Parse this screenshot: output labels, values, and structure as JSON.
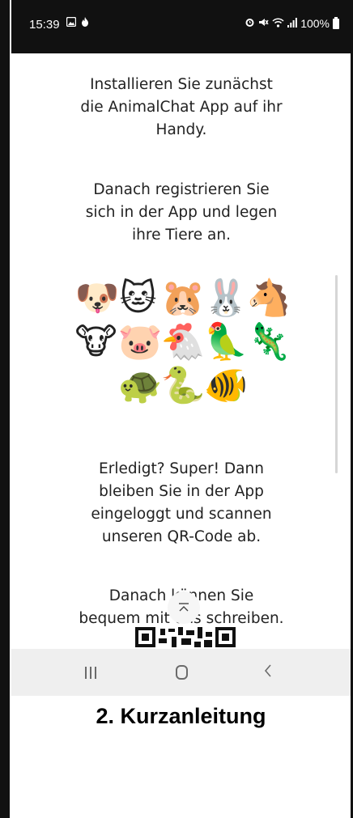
{
  "status_bar": {
    "time": "15:39",
    "battery_text": "100%",
    "left_icons": [
      "gallery-notification-icon",
      "fire-notification-icon"
    ],
    "right_icons": [
      "alarm-icon",
      "mute-icon",
      "wifi-icon",
      "signal-icon",
      "battery-icon"
    ]
  },
  "content": {
    "paragraphs": [
      {
        "lines": [
          "Installieren Sie zunächst",
          "die AnimalChat App auf ihr",
          "Handy."
        ]
      },
      {
        "lines": [
          "Danach registrieren Sie",
          "sich in der App und legen",
          "ihre Tiere an."
        ]
      },
      {
        "lines": [
          "Erledigt? Super! Dann",
          "bleiben Sie in der App",
          "eingeloggt und scannen",
          "unseren QR-Code ab."
        ]
      },
      {
        "lines": [
          "Danach können Sie",
          "bequem mit uns schreiben."
        ]
      }
    ],
    "emoji_rows": [
      [
        "🐶",
        "🐱",
        "🐹",
        "🐰",
        "🐴"
      ],
      [
        "🐮",
        "🐷",
        "🐔",
        "🦜",
        "🦎"
      ],
      [
        "🐢",
        "🐍",
        "🐠"
      ]
    ],
    "emoji_names": [
      [
        "dog-emoji",
        "cat-emoji",
        "hamster-emoji",
        "rabbit-emoji",
        "horse-emoji"
      ],
      [
        "cow-emoji",
        "pig-emoji",
        "rooster-emoji",
        "parrot-emoji",
        "lizard-emoji"
      ],
      [
        "turtle-emoji",
        "snake-emoji",
        "fish-emoji"
      ]
    ]
  },
  "scroll_top_icon": "chevron-up-icon",
  "nav_bar": {
    "icons": [
      "recent-apps-icon",
      "home-icon",
      "back-icon"
    ]
  },
  "caption": "2. Kurzanleitung"
}
